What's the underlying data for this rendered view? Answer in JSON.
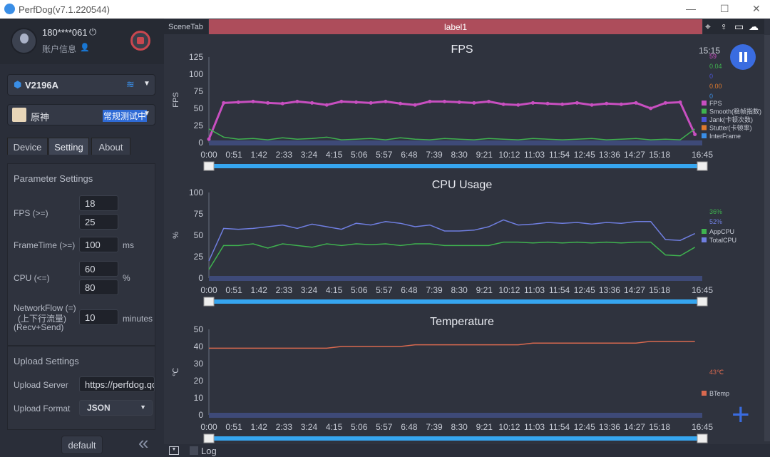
{
  "window": {
    "title": "PerfDog(v7.1.220544)"
  },
  "user": {
    "name": "180****061",
    "account_label": "账户信息"
  },
  "device": {
    "name": "V2196A",
    "icon": "android-icon",
    "connection": "wifi-icon"
  },
  "app": {
    "name": "原神",
    "status": "常规测试中"
  },
  "tabs": [
    {
      "label": "Device"
    },
    {
      "label": "Setting",
      "active": true
    },
    {
      "label": "About"
    }
  ],
  "parameter_settings": {
    "title": "Parameter Settings",
    "fps_label": "FPS (>=)",
    "fps_values": [
      "18",
      "25"
    ],
    "frametime_label": "FrameTime (>=)",
    "frametime_value": "100",
    "frametime_unit": "ms",
    "cpu_label": "CPU (<=)",
    "cpu_values": [
      "60",
      "80"
    ],
    "cpu_unit": "%",
    "network_label_1": "NetworkFlow (=)",
    "network_label_2": "(上下行流量)",
    "network_label_3": "(Recv+Send)",
    "network_value": "10",
    "network_unit": "minutes"
  },
  "upload_settings": {
    "title": "Upload Settings",
    "server_label": "Upload Server",
    "server_value": "https://perfdog.qq.com",
    "format_label": "Upload Format",
    "format_value": "JSON"
  },
  "sidebar_footer": {
    "default_label": "default",
    "collapse": "«"
  },
  "scene": {
    "tab_label": "SceneTab",
    "label": "label1",
    "icons": [
      "location-icon",
      "pin-icon",
      "folder-icon",
      "cloud-icon"
    ]
  },
  "clock": "15:15",
  "bottom": {
    "log_label": "Log"
  },
  "time_ticks": [
    "0:00",
    "0:51",
    "1:42",
    "2:33",
    "3:24",
    "4:15",
    "5:06",
    "5:57",
    "6:48",
    "7:39",
    "8:30",
    "9:21",
    "10:12",
    "11:03",
    "11:54",
    "12:45",
    "13:36",
    "14:27",
    "15:18",
    "16:45"
  ],
  "chart_data": [
    {
      "type": "line",
      "title": "FPS",
      "ylabel": "FPS",
      "ylim": [
        0,
        125
      ],
      "yticks": [
        0,
        25,
        50,
        75,
        100,
        125
      ],
      "x_seconds_step": 30,
      "legend": [
        {
          "name": "FPS",
          "color": "#c84fc0",
          "current": "59"
        },
        {
          "name": "Smooth(稳帧指数)",
          "color": "#3fb24f",
          "current": "0.04"
        },
        {
          "name": "Jank(卡顿次数)",
          "color": "#4a55d8",
          "current": "0"
        },
        {
          "name": "Stutter(卡顿率)",
          "color": "#e07a2e",
          "current": "0.00"
        },
        {
          "name": "InterFrame",
          "color": "#3a8ee6",
          "current": "0"
        }
      ],
      "series": [
        {
          "name": "FPS",
          "values": [
            5,
            58,
            59,
            60,
            58,
            57,
            60,
            58,
            55,
            60,
            59,
            58,
            60,
            57,
            55,
            60,
            60,
            59,
            58,
            60,
            56,
            55,
            58,
            57,
            56,
            58,
            55,
            57,
            56,
            58,
            50,
            58,
            59,
            12
          ]
        },
        {
          "name": "Smooth(稳帧指数)",
          "values": [
            20,
            8,
            5,
            6,
            4,
            7,
            5,
            6,
            8,
            4,
            5,
            6,
            4,
            7,
            5,
            4,
            6,
            5,
            4,
            6,
            5,
            4,
            6,
            5,
            4,
            5,
            6,
            4,
            5,
            6,
            4,
            5,
            4,
            20
          ]
        }
      ]
    },
    {
      "type": "line",
      "title": "CPU Usage",
      "ylabel": "%",
      "ylim": [
        0,
        100
      ],
      "yticks": [
        0,
        25,
        50,
        75,
        100
      ],
      "x_seconds_step": 30,
      "legend": [
        {
          "name": "AppCPU",
          "color": "#3fb24f",
          "current": "36%"
        },
        {
          "name": "TotalCPU",
          "color": "#6f7ee0",
          "current": "52%"
        }
      ],
      "series": [
        {
          "name": "TotalCPU",
          "values": [
            20,
            58,
            57,
            58,
            60,
            62,
            58,
            63,
            60,
            57,
            64,
            62,
            66,
            64,
            60,
            62,
            55,
            55,
            56,
            60,
            68,
            62,
            63,
            65,
            64,
            65,
            63,
            65,
            64,
            66,
            66,
            45,
            44,
            52
          ]
        },
        {
          "name": "AppCPU",
          "values": [
            10,
            38,
            38,
            40,
            35,
            40,
            38,
            36,
            40,
            38,
            40,
            39,
            40,
            38,
            40,
            40,
            38,
            38,
            38,
            38,
            42,
            42,
            41,
            42,
            41,
            42,
            41,
            42,
            41,
            42,
            42,
            27,
            26,
            36
          ]
        }
      ]
    },
    {
      "type": "line",
      "title": "Temperature",
      "ylabel": "℃",
      "ylim": [
        0,
        50
      ],
      "yticks": [
        0,
        10,
        20,
        30,
        40,
        50
      ],
      "x_seconds_step": 30,
      "legend": [
        {
          "name": "BTemp",
          "color": "#d9694f",
          "current": "43℃"
        }
      ],
      "series": [
        {
          "name": "BTemp",
          "values": [
            39,
            39,
            39,
            39,
            39,
            39,
            39,
            39,
            39,
            40,
            40,
            40,
            40,
            40,
            41,
            41,
            41,
            41,
            41,
            41,
            41,
            41,
            42,
            42,
            42,
            42,
            42,
            42,
            42,
            42,
            43,
            43,
            43,
            43
          ]
        }
      ]
    }
  ]
}
